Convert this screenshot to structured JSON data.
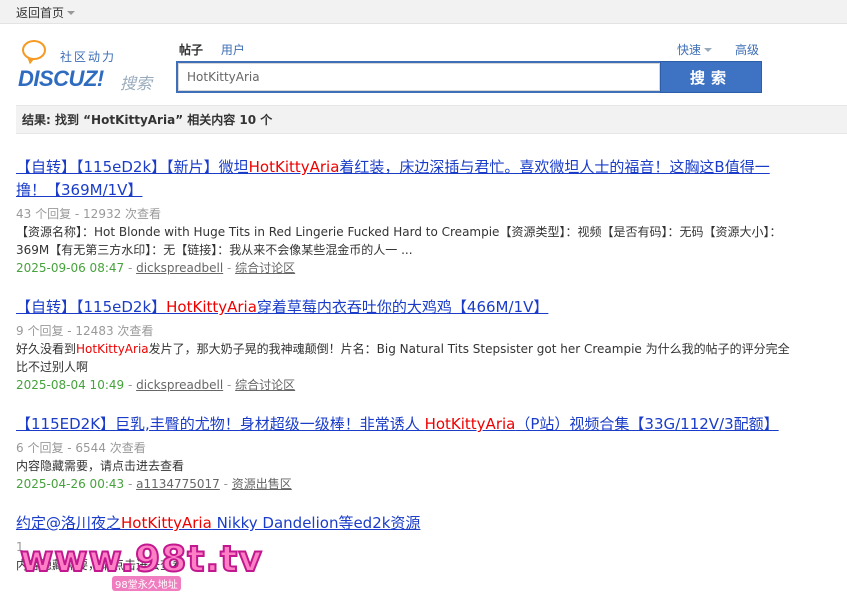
{
  "topbar": {
    "back_label": "返回首页"
  },
  "logo": {
    "tagline": "社区动力",
    "brand": "DISCUZ!",
    "brand_sub": "搜索"
  },
  "search": {
    "tabs": [
      {
        "label": "帖子",
        "active": true
      },
      {
        "label": "用户",
        "active": false
      }
    ],
    "quick_label": "快速",
    "advanced_label": "高级",
    "query": "HotKittyAria",
    "button_label": "搜索"
  },
  "result_bar": {
    "text": "结果: 找到 “HotKittyAria” 相关内容 10 个"
  },
  "results": [
    {
      "title_pre": "【自转】【115eD2k】【新片】微坦",
      "title_hl": "HotKittyAria",
      "title_post": "着红装，床边深插与君忙。喜欢微坦人士的福音！这胸这B值得一撸！【369M/1V】",
      "meta": "43 个回复 - 12932 次查看",
      "summary_pre": "【资源名称】：Hot Blonde with Huge Tits in Red Lingerie Fucked Hard to Creampie【资源类型】：视频【是否有码】：无码【资源大小】：369M【有无第三方水印】：无【链接】：我从来不会像某些混金币的人一 ...",
      "summary_hl": "",
      "summary_post": "",
      "date": "2025-09-06 08:47",
      "author": "dickspreadbell",
      "forum": "综合讨论区"
    },
    {
      "title_pre": "【自转】【115eD2k】",
      "title_hl": "HotKittyAria",
      "title_post": "穿着草莓内衣吞吐你的大鸡鸡【466M/1V】",
      "meta": "9 个回复 - 12483 次查看",
      "summary_pre": "好久没看到",
      "summary_hl": "HotKittyAria",
      "summary_post": "发片了，那大奶子晃的我神魂颠倒！片名：Big Natural Tits Stepsister got her Creampie 为什么我的帖子的评分完全比不过别人啊",
      "date": "2025-08-04 10:49",
      "author": "dickspreadbell",
      "forum": "综合讨论区"
    },
    {
      "title_pre": "【115ED2K】巨乳,丰臀的尤物！身材超级一级棒！非常诱人 ",
      "title_hl": "HotKittyAria",
      "title_post": "（P站）视频合集【33G/112V/3配额】",
      "meta": "6 个回复 - 6544 次查看",
      "summary_pre": "内容隐藏需要，请点击进去查看",
      "summary_hl": "",
      "summary_post": "",
      "date": "2025-04-26 00:43",
      "author": "a1134775017",
      "forum": "资源出售区"
    },
    {
      "title_pre": "约定@洛川夜之",
      "title_hl": "HotKittyAria",
      "title_post": " Nikky Dandelion等ed2k资源",
      "meta": "1",
      "summary_pre": "内容隐藏需要，请点击进去查看",
      "summary_hl": "",
      "summary_post": "",
      "date": "",
      "author": "",
      "forum": ""
    }
  ],
  "watermark": {
    "text": "www.98t.tv",
    "sub": "98堂永久地址"
  }
}
